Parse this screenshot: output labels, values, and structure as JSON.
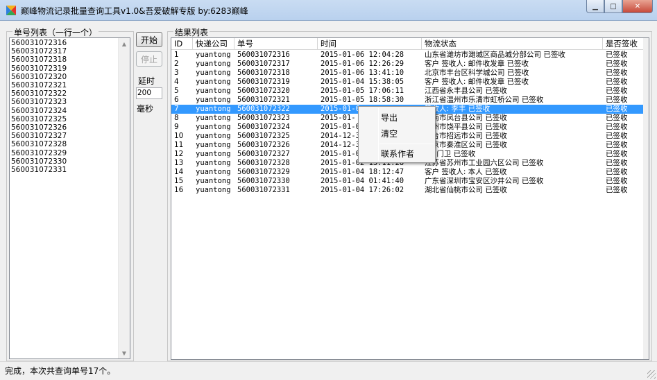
{
  "window": {
    "title": "巅峰物流记录批量查询工具v1.0&吾爱破解专版   by:6283巅峰",
    "minimize_glyph": "▁",
    "maximize_glyph": "□",
    "close_glyph": "✕",
    "icon": "app-logo-icon"
  },
  "left_panel": {
    "group_label": "单号列表（一行一个）",
    "tracking_numbers": [
      "560031072316",
      "560031072317",
      "560031072318",
      "560031072319",
      "560031072320",
      "560031072321",
      "560031072322",
      "560031072323",
      "560031072324",
      "560031072325",
      "560031072326",
      "560031072327",
      "560031072328",
      "560031072329",
      "560031072330",
      "560031072331"
    ]
  },
  "controls": {
    "start_label": "开始",
    "stop_label": "停止",
    "delay_label": "延时",
    "delay_value": "200",
    "unit_label": "毫秒"
  },
  "results": {
    "group_label": "结果列表",
    "columns": [
      "ID",
      "快递公司",
      "单号",
      "时间",
      "物流状态",
      "是否签收"
    ],
    "selected_row_index": 6,
    "rows": [
      [
        "1",
        "yuantong",
        "560031072316",
        "2015-01-06 12:04:28",
        "山东省潍坊市潍城区商品城分部公司 已签收",
        "已签收"
      ],
      [
        "2",
        "yuantong",
        "560031072317",
        "2015-01-06 12:26:29",
        "客户 签收人: 邮件收发章 已签收",
        "已签收"
      ],
      [
        "3",
        "yuantong",
        "560031072318",
        "2015-01-06 13:41:10",
        "北京市丰台区科学城公司 已签收",
        "已签收"
      ],
      [
        "4",
        "yuantong",
        "560031072319",
        "2015-01-04 15:38:05",
        "客户 签收人: 邮件收发章 已签收",
        "已签收"
      ],
      [
        "5",
        "yuantong",
        "560031072320",
        "2015-01-05 17:06:11",
        "江西省永丰县公司 已签收",
        "已签收"
      ],
      [
        "6",
        "yuantong",
        "560031072321",
        "2015-01-05 18:58:30",
        "浙江省温州市乐清市虹桥公司 已签收",
        "已签收"
      ],
      [
        "7",
        "yuantong",
        "560031072322",
        "2015-01-0",
        "签收人: 李丰 已签收",
        "已签收"
      ],
      [
        "8",
        "yuantong",
        "560031072323",
        "2015-01-",
        "淮南市凤台县公司 已签收",
        "已签收"
      ],
      [
        "9",
        "yuantong",
        "560031072324",
        "2015-01-0",
        "潮州市饶平县公司 已签收",
        "已签收"
      ],
      [
        "10",
        "yuantong",
        "560031072325",
        "2014-12-3",
        "烟台市招远市公司 已签收",
        "已签收"
      ],
      [
        "11",
        "yuantong",
        "560031072326",
        "2014-12-3",
        "南京市秦淮区公司 已签收",
        "已签收"
      ],
      [
        "12",
        "yuantong",
        "560031072327",
        "2015-01-0",
        "人: 门卫 已签收",
        "已签收"
      ],
      [
        "13",
        "yuantong",
        "560031072328",
        "2015-01-02 13:11:28",
        "江苏省苏州市工业园六区公司 已签收",
        "已签收"
      ],
      [
        "14",
        "yuantong",
        "560031072329",
        "2015-01-04 18:12:47",
        "客户 签收人: 本人 已签收",
        "已签收"
      ],
      [
        "15",
        "yuantong",
        "560031072330",
        "2015-01-04 01:41:40",
        "广东省深圳市宝安区沙井公司 已签收",
        "已签收"
      ],
      [
        "16",
        "yuantong",
        "560031072331",
        "2015-01-04 17:26:02",
        "湖北省仙桃市公司 已签收",
        "已签收"
      ]
    ]
  },
  "context_menu": {
    "export": "导出",
    "clear": "清空",
    "contact": "联系作者"
  },
  "status": {
    "text": "完成，本次共查询单号17个。"
  },
  "colors": {
    "selection": "#3399ff",
    "title_bar": "#c9dcf2",
    "close_button": "#c7493a"
  }
}
